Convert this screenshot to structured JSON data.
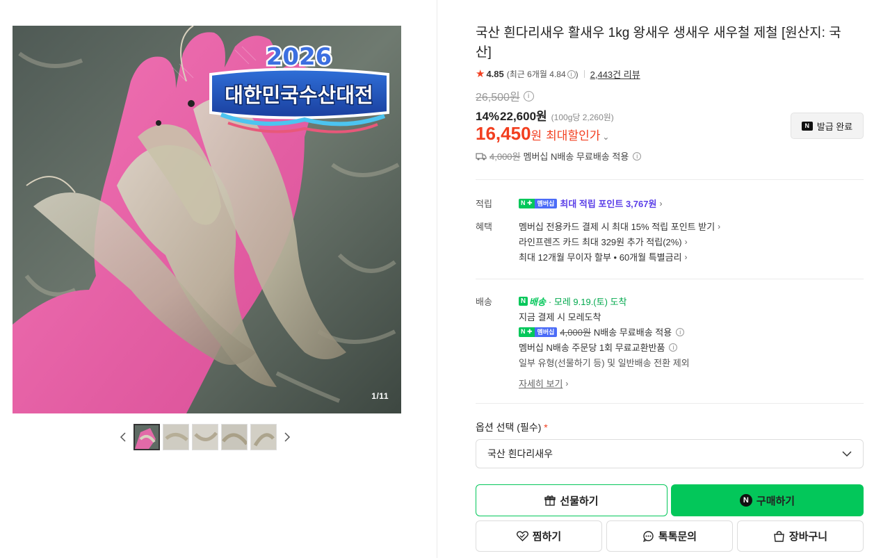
{
  "gallery": {
    "badge_year": "2026",
    "badge_text": "대한민국수산대전",
    "counter": "1/11",
    "thumbnail_count": 5
  },
  "product": {
    "title": "국산 흰다리새우 활새우 1kg 왕새우 생새우 새우철 제철 [원산지: 국산]",
    "rating": "4.85",
    "rating_recent": "(최근 6개월 4.84",
    "rating_recent_close": ")",
    "review_count": "2,443건 리뷰",
    "original_price": "26,500원",
    "discount_percent": "14%",
    "sale_price": "22,600원",
    "unit_price": "(100g당 2,260원)",
    "max_discount_amount": "16,450",
    "max_discount_won": "원",
    "max_discount_label": "최대할인가",
    "coupon_button": "발급 완료",
    "shipping_fee_original": "4,000원",
    "shipping_fee_note": "멤버십 N배송 무료배송 적용"
  },
  "benefits": {
    "earn_label": "적립",
    "membership_badge_n": "N ✚",
    "membership_badge_text": "멤버십",
    "max_points": "최대 적립 포인트 3,767원",
    "benefit_label": "혜택",
    "lines": [
      "멤버십 전용카드 결제 시 최대 15% 적립 포인트 받기",
      "라인프렌즈 카드 최대 329원 추가 적립(2%)",
      "최대 12개월 무이자 할부 • 60개월 특별금리"
    ]
  },
  "delivery": {
    "label": "배송",
    "n_delivery": "배송",
    "arrival": "· 모레 9.19.(토) 도착",
    "line1": "지금 결제 시 모레도착",
    "fee_original": "4,000원",
    "fee_note": "N배송 무료배송 적용",
    "line3": "멤버십 N배송 주문당 1회 무료교환반품",
    "line4": "일부 유형(선물하기 등) 및 일반배송 전환 제외",
    "detail_link": "자세히 보기"
  },
  "options": {
    "label": "옵션 선택 (필수)",
    "required_mark": "*",
    "selected": "국산 흰다리새우"
  },
  "actions": {
    "gift": "선물하기",
    "buy": "구매하기",
    "wish": "찜하기",
    "talk": "톡톡문의",
    "cart": "장바구니"
  },
  "colors": {
    "accent_green": "#03c75a",
    "price_red": "#f23e1f",
    "points_purple": "#5b3fe8"
  }
}
